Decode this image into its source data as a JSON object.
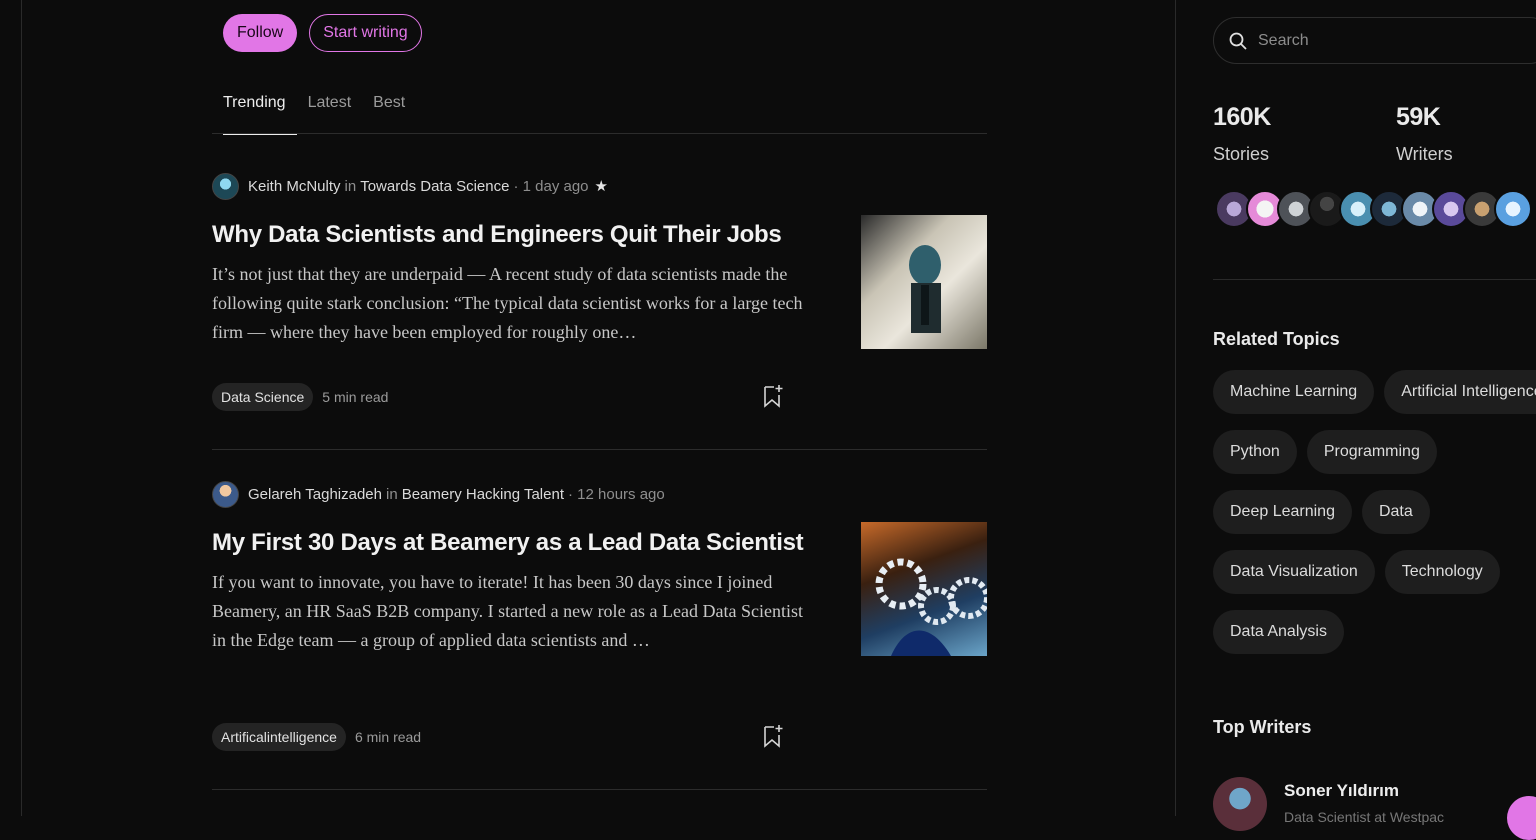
{
  "header": {
    "follow_label": "Follow",
    "start_writing_label": "Start writing"
  },
  "tabs": [
    {
      "label": "Trending",
      "active": true
    },
    {
      "label": "Latest",
      "active": false
    },
    {
      "label": "Best",
      "active": false
    }
  ],
  "articles": [
    {
      "author": "Keith McNulty",
      "in_word": "in",
      "publication": "Towards Data Science",
      "time": "· 1 day ago",
      "starred_icon": "★",
      "title": "Why Data Scientists and Engineers Quit Their Jobs",
      "summary": "It’s not just that they are underpaid — A recent study of data scientists made the following quite stark conclusion: “The typical data scientist works for a large tech firm — where they have been employed for roughly one…",
      "tag": "Data Science",
      "read_time": "5 min read"
    },
    {
      "author": "Gelareh Taghizadeh",
      "in_word": "in",
      "publication": "Beamery Hacking Talent",
      "time": "· 12 hours ago",
      "title": "My First 30 Days at Beamery as a Lead Data Scientist",
      "summary": "If you want to innovate, you have to iterate! It has been 30 days since I joined Beamery, an HR SaaS B2B company. I started a new role as a Lead Data Scientist in the Edge team — a group of applied data scientists and …",
      "tag": "Artificalintelligence",
      "read_time": "6 min read"
    }
  ],
  "sidebar": {
    "search_placeholder": "Search",
    "stats": [
      {
        "value": "160K",
        "label": "Stories"
      },
      {
        "value": "59K",
        "label": "Writers"
      }
    ],
    "related_topics_title": "Related Topics",
    "related_topics": [
      [
        "Machine Learning",
        "Artificial Intelligence"
      ],
      [
        "Python",
        "Programming"
      ],
      [
        "Deep Learning",
        "Data"
      ],
      [
        "Data Visualization",
        "Technology"
      ],
      [
        "Data Analysis"
      ]
    ],
    "top_writers_title": "Top Writers",
    "top_writer": {
      "name": "Soner Yıldırım",
      "bio": "Data Scientist at Westpac"
    }
  },
  "colors": {
    "accent": "#e176e6",
    "background": "#0c0c0c",
    "chip": "#242424"
  }
}
